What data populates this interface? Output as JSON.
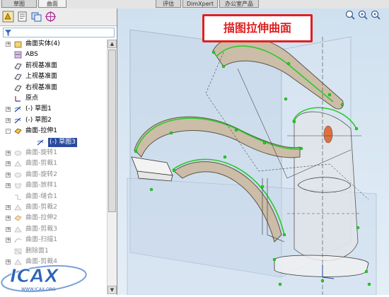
{
  "tabs": [
    {
      "label": "草图"
    },
    {
      "label": "曲面"
    },
    {
      "label": "评估"
    },
    {
      "label": "DimXpert"
    },
    {
      "label": "办公室产品"
    }
  ],
  "callout": {
    "text": "描图拉伸曲面"
  },
  "tree": {
    "items": [
      {
        "label": "曲面实体(4)",
        "icon": "folder-icon",
        "expander": "+"
      },
      {
        "label": "ABS",
        "icon": "material-icon",
        "expander": ""
      },
      {
        "label": "前视基准面",
        "icon": "plane-icon",
        "expander": ""
      },
      {
        "label": "上视基准面",
        "icon": "plane-icon",
        "expander": ""
      },
      {
        "label": "右视基准面",
        "icon": "plane-icon",
        "expander": ""
      },
      {
        "label": "原点",
        "icon": "origin-icon",
        "expander": ""
      },
      {
        "label": "(-) 草图1",
        "icon": "sketch-icon",
        "expander": "+"
      },
      {
        "label": "(-) 草图2",
        "icon": "sketch-icon",
        "expander": "+"
      },
      {
        "label": "曲面-拉伸1",
        "icon": "extrude-icon",
        "expander": "-"
      },
      {
        "label": "(-) 草图3",
        "icon": "sketch-icon",
        "expander": "",
        "selected": true
      },
      {
        "label": "曲面-旋转1",
        "icon": "revolve-icon",
        "expander": "+",
        "dim": true
      },
      {
        "label": "曲面-剪裁1",
        "icon": "trim-icon",
        "expander": "+",
        "dim": true
      },
      {
        "label": "曲面-旋转2",
        "icon": "revolve-icon",
        "expander": "+",
        "dim": true
      },
      {
        "label": "曲面-放样1",
        "icon": "loft-icon",
        "expander": "+",
        "dim": true
      },
      {
        "label": "曲面-缝合1",
        "icon": "knit-icon",
        "expander": "",
        "dim": true
      },
      {
        "label": "曲面-剪裁2",
        "icon": "trim-icon",
        "expander": "+",
        "dim": true
      },
      {
        "label": "曲面-拉伸2",
        "icon": "extrude-icon",
        "expander": "+",
        "dim": true
      },
      {
        "label": "曲面-剪裁3",
        "icon": "trim-icon",
        "expander": "+",
        "dim": true
      },
      {
        "label": "曲面-扫描1",
        "icon": "sweep-icon",
        "expander": "+",
        "dim": true
      },
      {
        "label": "删除面1",
        "icon": "delete-face-icon",
        "expander": "",
        "dim": true
      },
      {
        "label": "曲面-剪裁4",
        "icon": "trim-icon",
        "expander": "+",
        "dim": true
      }
    ]
  },
  "watermark": {
    "text": "ICAX",
    "url": "WWW.ICAX.ORG"
  }
}
